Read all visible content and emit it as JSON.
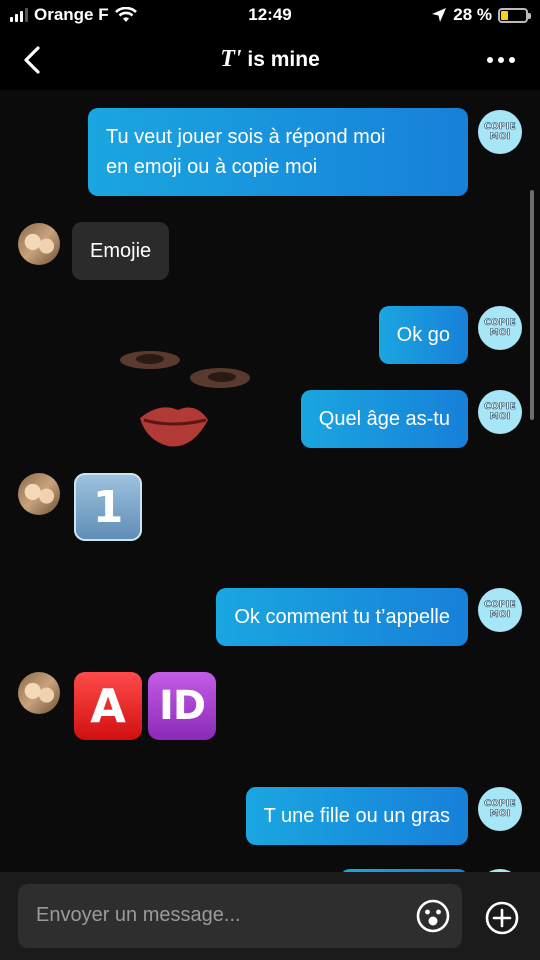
{
  "status_bar": {
    "carrier": "Orange F",
    "time": "12:49",
    "battery_percent": "28 %",
    "battery_level": 0.28
  },
  "header": {
    "title_prefix": "T'",
    "title_rest": "is mine"
  },
  "messages": [
    {
      "from": "me",
      "text_line1": "Tu veut jouer sois à répond moi",
      "text_line2": "en emoji ou à copie moi"
    },
    {
      "from": "them",
      "text": "Emojie"
    },
    {
      "from": "me",
      "text": "Ok go"
    },
    {
      "from": "me",
      "text": "Quel âge as-tu"
    },
    {
      "from": "them",
      "emoji": [
        "1"
      ]
    },
    {
      "from": "me",
      "text": "Ok comment tu t’appelle"
    },
    {
      "from": "them",
      "emoji": [
        "A",
        "ID"
      ]
    },
    {
      "from": "me",
      "text": "T une fille ou un gras"
    }
  ],
  "bot_avatar": {
    "line1": "COPIE",
    "line2": "MOI"
  },
  "composer": {
    "placeholder": "Envoyer un message..."
  },
  "colors": {
    "outgoing_bubble": "#1a8fdc",
    "incoming_bubble": "#2b2b2b",
    "background": "#0b0b0b",
    "battery": "#f4d21f"
  },
  "icons": {
    "back": "chevron-left-icon",
    "more": "ellipsis-icon",
    "emoji": "smiley-icon",
    "add": "plus-circle-icon"
  }
}
